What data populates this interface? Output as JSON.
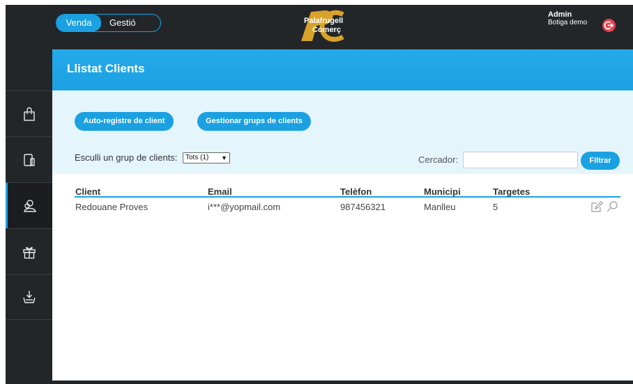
{
  "header": {
    "toggle": {
      "sale_label": "Venda",
      "manage_label": "Gestió"
    },
    "logo": {
      "line1": "Palafrugell",
      "line2": "Comerç"
    },
    "user": {
      "name": "Admin",
      "shop": "Botiga demo"
    }
  },
  "sidebar": {
    "items": [
      {
        "icon": "shopping-bag-icon",
        "active": false
      },
      {
        "icon": "device-icon",
        "active": false
      },
      {
        "icon": "users-icon",
        "active": true
      },
      {
        "icon": "gift-icon",
        "active": false
      },
      {
        "icon": "download-tray-icon",
        "active": false
      }
    ]
  },
  "main": {
    "title": "Llistat Clients",
    "buttons": {
      "auto_register": "Auto-registre de client",
      "manage_groups": "Gestionar grups de clients",
      "filter": "Filtrar"
    },
    "filters": {
      "group_label": "Esculli un grup de clients:",
      "group_selected": "Tots (1)",
      "search_label": "Cercador:",
      "search_value": ""
    },
    "table": {
      "columns": [
        "Client",
        "Email",
        "Telèfon",
        "Municipi",
        "Targetes"
      ],
      "rows": [
        [
          "Redouane Proves",
          "i***@yopmail.com",
          "987456321",
          "Manlleu",
          "5"
        ]
      ]
    }
  },
  "colors": {
    "accent": "#1ba1e2",
    "dark": "#232629",
    "panel": "#e5f5fc",
    "logout": "#e8414f",
    "logo_gold": "#d9a22a"
  }
}
